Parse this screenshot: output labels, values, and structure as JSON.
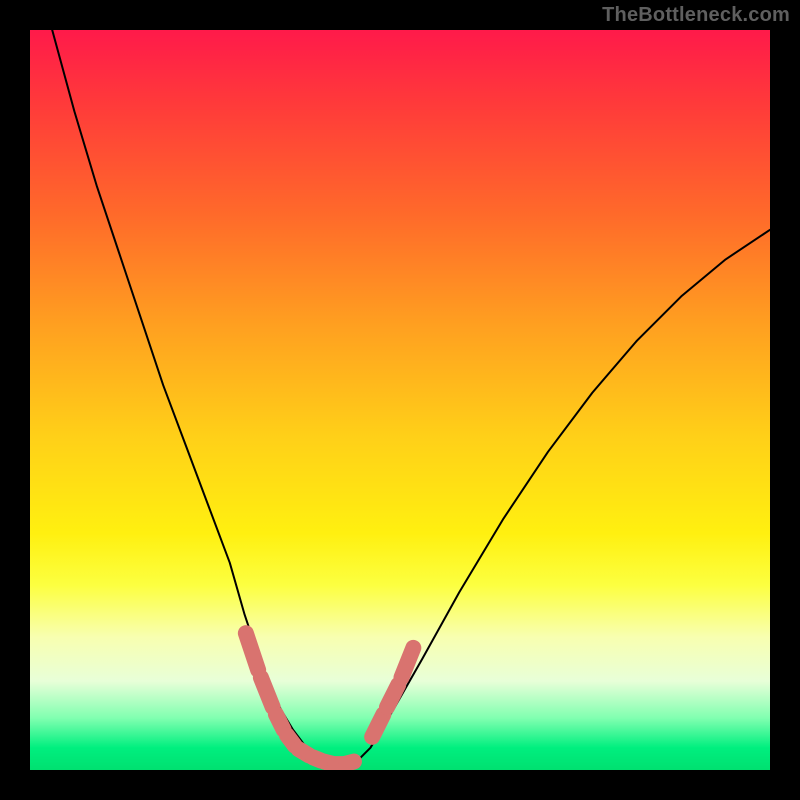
{
  "watermark": "TheBottleneck.com",
  "chart_data": {
    "type": "line",
    "title": "",
    "xlabel": "",
    "ylabel": "",
    "xlim": [
      0,
      100
    ],
    "ylim": [
      0,
      100
    ],
    "series": [
      {
        "name": "left-curve",
        "x": [
          3,
          6,
          9,
          12,
          15,
          18,
          21,
          24,
          27,
          29,
          31,
          32.5,
          34,
          35.5,
          37,
          38.5,
          40
        ],
        "y": [
          100,
          89,
          79,
          70,
          61,
          52,
          44,
          36,
          28,
          21,
          15,
          11,
          8,
          5.5,
          3.5,
          2,
          1
        ]
      },
      {
        "name": "right-curve",
        "x": [
          44,
          46,
          49,
          53,
          58,
          64,
          70,
          76,
          82,
          88,
          94,
          100
        ],
        "y": [
          1,
          3,
          8,
          15,
          24,
          34,
          43,
          51,
          58,
          64,
          69,
          73
        ]
      },
      {
        "name": "floor",
        "x": [
          40,
          41.5,
          43,
          44
        ],
        "y": [
          1,
          0.6,
          0.6,
          1
        ]
      }
    ],
    "highlight_segments": [
      {
        "name": "left-marker-run",
        "x": [
          29,
          31,
          33,
          34.5,
          36,
          38,
          39.5,
          41,
          42.5,
          44
        ],
        "y": [
          19,
          13,
          8,
          5,
          3,
          1.8,
          1.2,
          0.8,
          0.8,
          1.2
        ]
      },
      {
        "name": "right-marker-run",
        "x": [
          46,
          48,
          50,
          52
        ],
        "y": [
          4,
          8,
          12,
          17
        ]
      }
    ],
    "colors": {
      "curve": "#000000",
      "marker": "#d9736f",
      "gradient_top": "#ff1a4a",
      "gradient_bottom": "#00e070"
    }
  }
}
